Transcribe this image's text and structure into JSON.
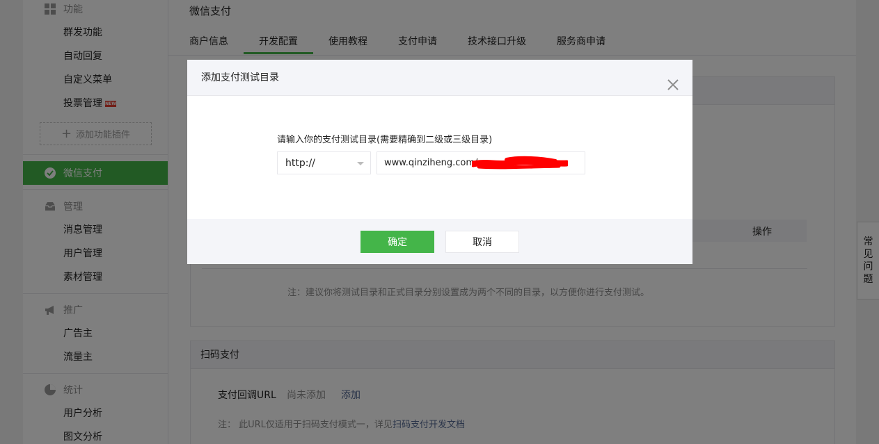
{
  "sidebar": {
    "section_function": "功能",
    "items_function": [
      "群发功能",
      "自动回复",
      "自定义菜单",
      "投票管理"
    ],
    "new_badge": "NEW",
    "add_plugin": "添加功能插件",
    "active_item": "微信支付",
    "section_manage": "管理",
    "items_manage": [
      "消息管理",
      "用户管理",
      "素材管理"
    ],
    "section_promote": "推广",
    "items_promote": [
      "广告主",
      "流量主"
    ],
    "section_stats": "统计",
    "items_stats": [
      "用户分析",
      "图文分析"
    ]
  },
  "main": {
    "title": "微信支付",
    "tabs": [
      "商户信息",
      "开发配置",
      "使用教程",
      "支付申请",
      "技术接口升级",
      "服务商申请"
    ],
    "active_tab": "开发配置",
    "op_label": "操作",
    "test_dir_note": "注：建议你将测试目录和正式目录分别设置成为两个不同的目录，以方便你进行支付测试。",
    "scan_pay": {
      "title": "扫码支付",
      "callback_label": "支付回调URL",
      "callback_value": "尚未添加",
      "add_link": "添加",
      "note_prefix": "注： 此URL仅适用于扫码支付模式一，详见",
      "note_link": "扫码支付开发文档"
    }
  },
  "faq": [
    "常",
    "见",
    "问",
    "题"
  ],
  "dialog": {
    "title": "添加支付测试目录",
    "prompt": "请输入你的支付测试目录(需要精确到二级或三级目录)",
    "protocol_selected": "http://",
    "path_value": "www.qinziheng.com/",
    "confirm": "确定",
    "cancel": "取消"
  },
  "colors": {
    "accent": "#44b549",
    "link": "#576b95",
    "redaction": "#ff0000"
  }
}
